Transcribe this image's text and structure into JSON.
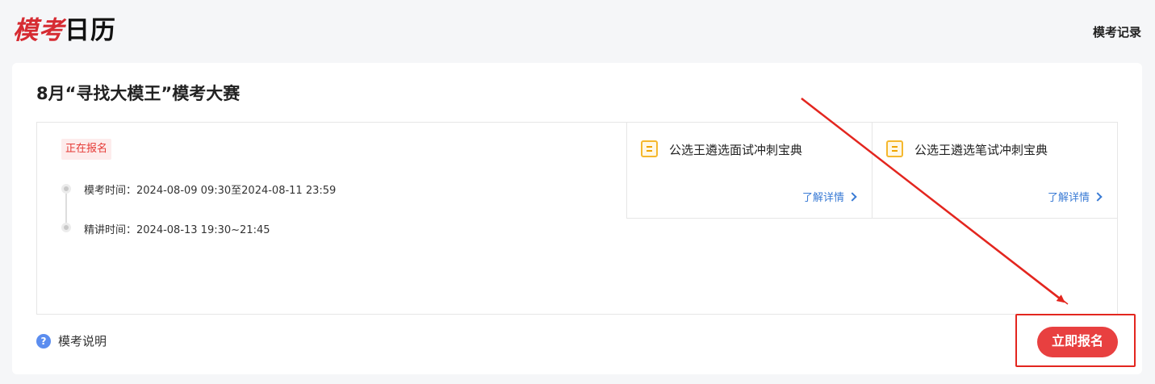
{
  "header": {
    "logo_part1": "模考",
    "logo_part2": "日历",
    "records_label": "模考记录"
  },
  "exam": {
    "title": "8月“寻找大模王”模考大赛",
    "status": "正在报名",
    "timeline": [
      {
        "text": "模考时间：2024-08-09 09:30至2024-08-11 23:59"
      },
      {
        "text": "精讲时间：2024-08-13 19:30~21:45"
      }
    ],
    "resources": [
      {
        "title": "公选王遴选面试冲刺宝典",
        "link": "了解详情",
        "icon": "document-icon"
      },
      {
        "title": "公选王遴选笔试冲刺宝典",
        "link": "了解详情",
        "icon": "document-icon"
      }
    ],
    "help_icon": "?",
    "help_label": "模考说明",
    "signup_label": "立即报名"
  },
  "colors": {
    "accent_red": "#e84040",
    "link_blue": "#3a7bd5",
    "badge_bg": "#fdecec",
    "annotation_red": "#e3261f"
  }
}
